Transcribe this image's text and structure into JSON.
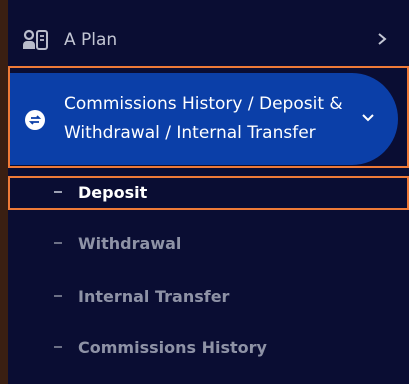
{
  "sidebar": {
    "a_plan": {
      "label": "A Plan",
      "icon": "id-card-icon",
      "chevron": "chevron-right-icon"
    },
    "active_group": {
      "label": "Commissions History / Deposit & Withdrawal / Internal Transfer",
      "icon": "transfer-icon",
      "chevron": "chevron-down-icon"
    },
    "sub_items": [
      {
        "label": "Deposit",
        "current": true
      },
      {
        "label": "Withdrawal",
        "current": false
      },
      {
        "label": "Internal Transfer",
        "current": false
      },
      {
        "label": "Commissions History",
        "current": false
      }
    ]
  },
  "colors": {
    "sidebar_bg": "#0a0d33",
    "active_pill": "#0b3fa8",
    "highlight_border": "#ee7a38",
    "frame_bg": "#3a1f12"
  }
}
